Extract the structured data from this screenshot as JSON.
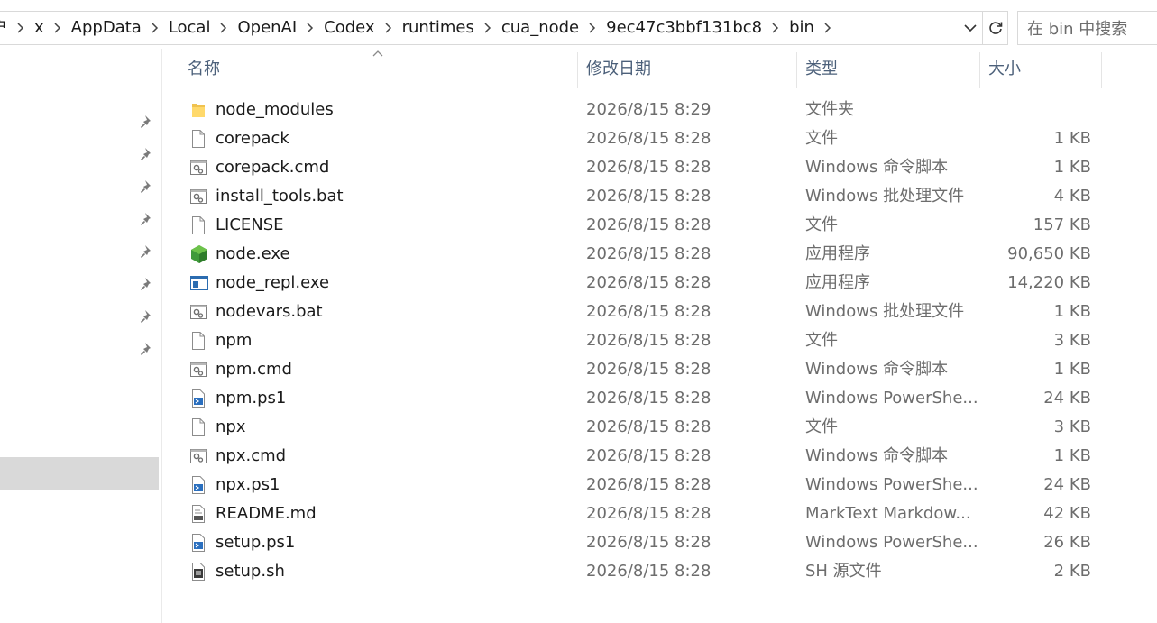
{
  "breadcrumb": {
    "items": [
      "户",
      "x",
      "AppData",
      "Local",
      "OpenAI",
      "Codex",
      "runtimes",
      "cua_node",
      "9ec47c3bbf131bc8",
      "bin"
    ]
  },
  "search": {
    "placeholder": "在 bin 中搜索"
  },
  "nav": {
    "fragments": [
      ")",
      ")"
    ]
  },
  "columns": {
    "name": "名称",
    "date": "修改日期",
    "type": "类型",
    "size": "大小"
  },
  "files": [
    {
      "name": "node_modules",
      "date": "2026/8/15 8:29",
      "type": "文件夹",
      "size": "",
      "icon": "folder-icon"
    },
    {
      "name": "corepack",
      "date": "2026/8/15 8:28",
      "type": "文件",
      "size": "1 KB",
      "icon": "file-icon"
    },
    {
      "name": "corepack.cmd",
      "date": "2026/8/15 8:28",
      "type": "Windows 命令脚本",
      "size": "1 KB",
      "icon": "script-gear-icon"
    },
    {
      "name": "install_tools.bat",
      "date": "2026/8/15 8:28",
      "type": "Windows 批处理文件",
      "size": "4 KB",
      "icon": "script-gear-icon"
    },
    {
      "name": "LICENSE",
      "date": "2026/8/15 8:28",
      "type": "文件",
      "size": "157 KB",
      "icon": "file-icon"
    },
    {
      "name": "node.exe",
      "date": "2026/8/15 8:28",
      "type": "应用程序",
      "size": "90,650 KB",
      "icon": "nodejs-hexagon-icon"
    },
    {
      "name": "node_repl.exe",
      "date": "2026/8/15 8:28",
      "type": "应用程序",
      "size": "14,220 KB",
      "icon": "application-window-icon"
    },
    {
      "name": "nodevars.bat",
      "date": "2026/8/15 8:28",
      "type": "Windows 批处理文件",
      "size": "1 KB",
      "icon": "script-gear-icon"
    },
    {
      "name": "npm",
      "date": "2026/8/15 8:28",
      "type": "文件",
      "size": "3 KB",
      "icon": "file-icon"
    },
    {
      "name": "npm.cmd",
      "date": "2026/8/15 8:28",
      "type": "Windows 命令脚本",
      "size": "1 KB",
      "icon": "script-gear-icon"
    },
    {
      "name": "npm.ps1",
      "date": "2026/8/15 8:28",
      "type": "Windows PowerShe...",
      "size": "24 KB",
      "icon": "powershell-script-icon"
    },
    {
      "name": "npx",
      "date": "2026/8/15 8:28",
      "type": "文件",
      "size": "3 KB",
      "icon": "file-icon"
    },
    {
      "name": "npx.cmd",
      "date": "2026/8/15 8:28",
      "type": "Windows 命令脚本",
      "size": "1 KB",
      "icon": "script-gear-icon"
    },
    {
      "name": "npx.ps1",
      "date": "2026/8/15 8:28",
      "type": "Windows PowerShe...",
      "size": "24 KB",
      "icon": "powershell-script-icon"
    },
    {
      "name": "README.md",
      "date": "2026/8/15 8:28",
      "type": "MarkText Markdow...",
      "size": "42 KB",
      "icon": "markdown-doc-icon"
    },
    {
      "name": "setup.ps1",
      "date": "2026/8/15 8:28",
      "type": "Windows PowerShe...",
      "size": "26 KB",
      "icon": "powershell-script-icon"
    },
    {
      "name": "setup.sh",
      "date": "2026/8/15 8:28",
      "type": "SH 源文件",
      "size": "2 KB",
      "icon": "shell-script-icon"
    }
  ]
}
